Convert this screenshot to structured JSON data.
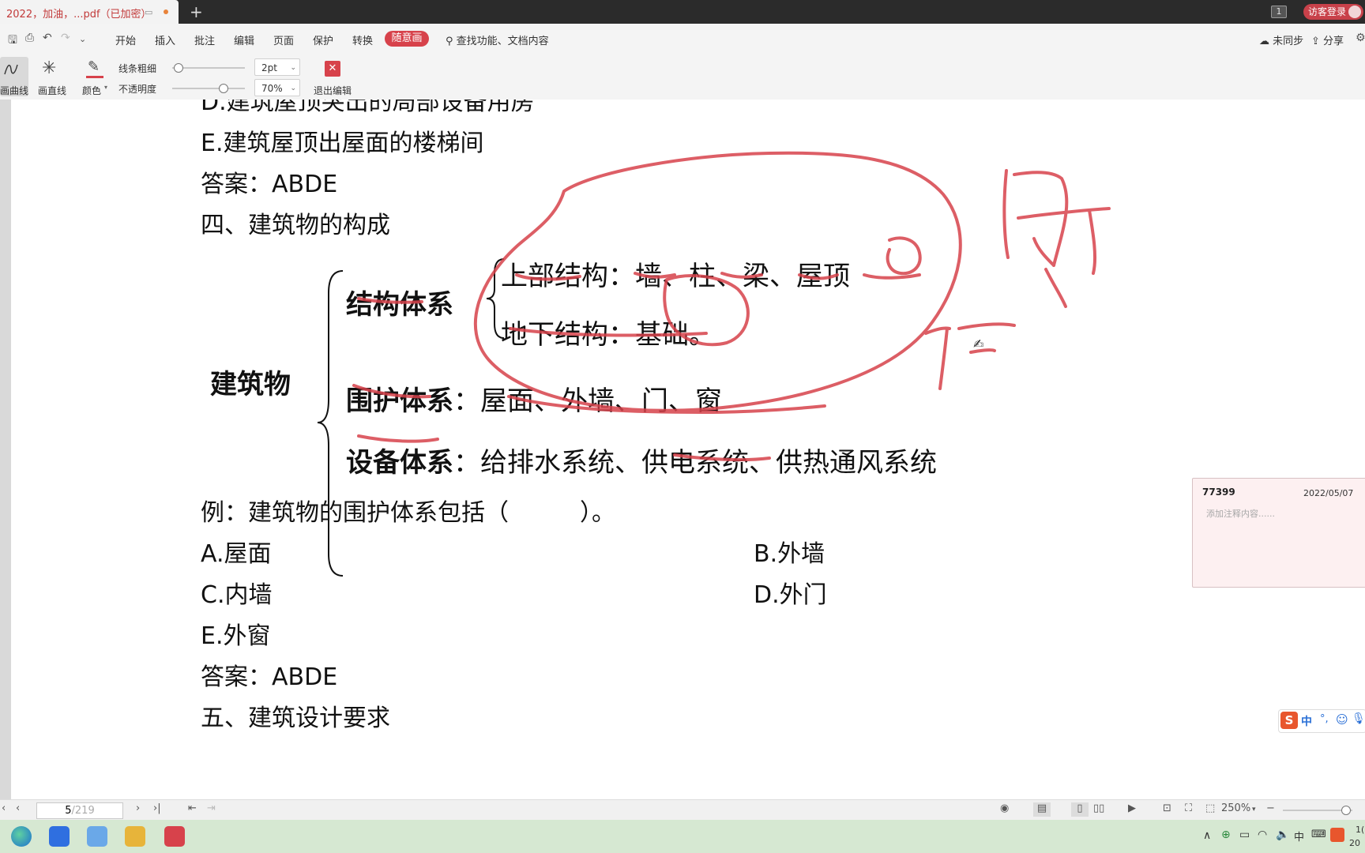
{
  "window": {
    "tab_title": "2022，加油，...pdf（已加密）",
    "new_tab": "+",
    "page_badge": "1",
    "login_button": "访客登录"
  },
  "menubar": {
    "items": [
      "开始",
      "插入",
      "批注",
      "编辑",
      "页面",
      "保护",
      "转换"
    ],
    "active_item": "随意画",
    "search": "查找功能、文档内容",
    "sync": "未同步",
    "share": "分享"
  },
  "ink_toolbar": {
    "draw_curve": "画曲线",
    "draw_line": "画直线",
    "color": "颜色",
    "line_width_label": "线条粗细",
    "line_width_value": "2pt",
    "opacity_label": "不透明度",
    "opacity_value": "70%",
    "opacity_level": 0.7,
    "exit_edit": "退出编辑",
    "ink_color": "#d7424b"
  },
  "document": {
    "partial_top": "D.建筑屋顶突出的局部设备用房",
    "line_e": "E.建筑屋顶出屋面的楼梯间",
    "answer1": "答案：ABDE",
    "section4": "四、建筑物的构成",
    "diagram": {
      "root": "建筑物",
      "structure": "结构体系",
      "upper_label": "上部结构",
      "upper_items": "墙、柱、梁、屋顶",
      "lower_label": "地下结构",
      "lower_items": "基础。",
      "enclosure": "围护体系",
      "enclosure_items": "屋面、外墙、门、窗",
      "equipment": "设备体系",
      "equipment_items": "给排水系统、供电系统、供热通风系统",
      "colon": "："
    },
    "example": "例：建筑物的围护体系包括（　　　）。",
    "option_a": "A.屋面",
    "option_b": "B.外墙",
    "option_c": "C.内墙",
    "option_d": "D.外门",
    "option_e": "E.外窗",
    "answer2": "答案：ABDE",
    "section5": "五、建筑设计要求"
  },
  "comment": {
    "author": "77399",
    "date": "2022/05/07",
    "placeholder": "添加注释内容......"
  },
  "ime": {
    "logo": "S",
    "mode": "中"
  },
  "statusbar": {
    "current_page": "5",
    "total_pages": "/219",
    "zoom": "250%"
  },
  "taskbar": {
    "tray_ime": "中",
    "clock_top": "1(",
    "clock_bottom": "20"
  }
}
